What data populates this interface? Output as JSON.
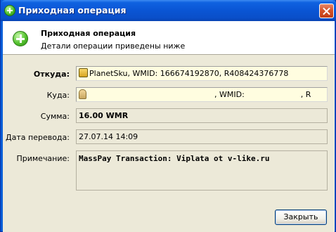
{
  "window": {
    "title": "Приходная операция"
  },
  "header": {
    "title": "Приходная операция",
    "subtitle": "Детали операции приведены ниже"
  },
  "form": {
    "from": {
      "label": "Откуда:",
      "value": "PlanetSku, WMID: 166674192870, R408424376778"
    },
    "to": {
      "label": "Куда:",
      "value_parts": [
        ", WMID:",
        ", R"
      ]
    },
    "amount": {
      "label": "Сумма:",
      "value": "16.00 WMR"
    },
    "date": {
      "label": "Дата перевода:",
      "value": "27.07.14 14:09"
    },
    "note": {
      "label": "Примечание:",
      "value": "MassPay Transaction: Viplata ot v-like.ru"
    }
  },
  "buttons": {
    "close_label": "Закрыть"
  },
  "icons": {
    "title": "plus-icon",
    "header": "plus-icon",
    "from": "webmoney-icon",
    "to": "user-icon"
  }
}
